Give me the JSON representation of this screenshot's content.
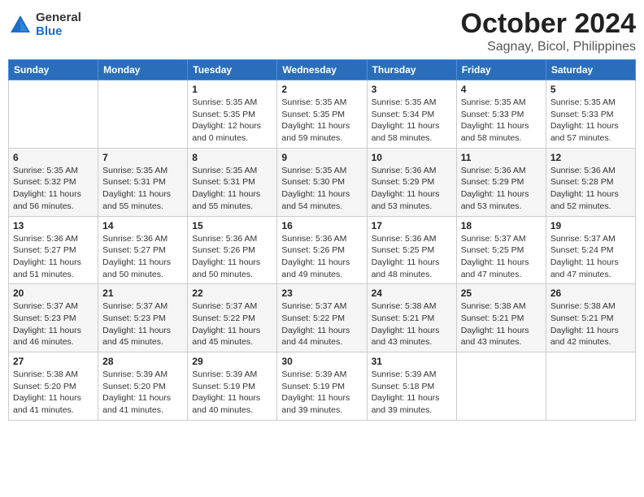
{
  "logo": {
    "general": "General",
    "blue": "Blue"
  },
  "title": "October 2024",
  "location": "Sagnay, Bicol, Philippines",
  "days_header": [
    "Sunday",
    "Monday",
    "Tuesday",
    "Wednesday",
    "Thursday",
    "Friday",
    "Saturday"
  ],
  "weeks": [
    [
      {
        "day": "",
        "sunrise": "",
        "sunset": "",
        "daylight": ""
      },
      {
        "day": "",
        "sunrise": "",
        "sunset": "",
        "daylight": ""
      },
      {
        "day": "1",
        "sunrise": "Sunrise: 5:35 AM",
        "sunset": "Sunset: 5:35 PM",
        "daylight": "Daylight: 12 hours and 0 minutes."
      },
      {
        "day": "2",
        "sunrise": "Sunrise: 5:35 AM",
        "sunset": "Sunset: 5:35 PM",
        "daylight": "Daylight: 11 hours and 59 minutes."
      },
      {
        "day": "3",
        "sunrise": "Sunrise: 5:35 AM",
        "sunset": "Sunset: 5:34 PM",
        "daylight": "Daylight: 11 hours and 58 minutes."
      },
      {
        "day": "4",
        "sunrise": "Sunrise: 5:35 AM",
        "sunset": "Sunset: 5:33 PM",
        "daylight": "Daylight: 11 hours and 58 minutes."
      },
      {
        "day": "5",
        "sunrise": "Sunrise: 5:35 AM",
        "sunset": "Sunset: 5:33 PM",
        "daylight": "Daylight: 11 hours and 57 minutes."
      }
    ],
    [
      {
        "day": "6",
        "sunrise": "Sunrise: 5:35 AM",
        "sunset": "Sunset: 5:32 PM",
        "daylight": "Daylight: 11 hours and 56 minutes."
      },
      {
        "day": "7",
        "sunrise": "Sunrise: 5:35 AM",
        "sunset": "Sunset: 5:31 PM",
        "daylight": "Daylight: 11 hours and 55 minutes."
      },
      {
        "day": "8",
        "sunrise": "Sunrise: 5:35 AM",
        "sunset": "Sunset: 5:31 PM",
        "daylight": "Daylight: 11 hours and 55 minutes."
      },
      {
        "day": "9",
        "sunrise": "Sunrise: 5:35 AM",
        "sunset": "Sunset: 5:30 PM",
        "daylight": "Daylight: 11 hours and 54 minutes."
      },
      {
        "day": "10",
        "sunrise": "Sunrise: 5:36 AM",
        "sunset": "Sunset: 5:29 PM",
        "daylight": "Daylight: 11 hours and 53 minutes."
      },
      {
        "day": "11",
        "sunrise": "Sunrise: 5:36 AM",
        "sunset": "Sunset: 5:29 PM",
        "daylight": "Daylight: 11 hours and 53 minutes."
      },
      {
        "day": "12",
        "sunrise": "Sunrise: 5:36 AM",
        "sunset": "Sunset: 5:28 PM",
        "daylight": "Daylight: 11 hours and 52 minutes."
      }
    ],
    [
      {
        "day": "13",
        "sunrise": "Sunrise: 5:36 AM",
        "sunset": "Sunset: 5:27 PM",
        "daylight": "Daylight: 11 hours and 51 minutes."
      },
      {
        "day": "14",
        "sunrise": "Sunrise: 5:36 AM",
        "sunset": "Sunset: 5:27 PM",
        "daylight": "Daylight: 11 hours and 50 minutes."
      },
      {
        "day": "15",
        "sunrise": "Sunrise: 5:36 AM",
        "sunset": "Sunset: 5:26 PM",
        "daylight": "Daylight: 11 hours and 50 minutes."
      },
      {
        "day": "16",
        "sunrise": "Sunrise: 5:36 AM",
        "sunset": "Sunset: 5:26 PM",
        "daylight": "Daylight: 11 hours and 49 minutes."
      },
      {
        "day": "17",
        "sunrise": "Sunrise: 5:36 AM",
        "sunset": "Sunset: 5:25 PM",
        "daylight": "Daylight: 11 hours and 48 minutes."
      },
      {
        "day": "18",
        "sunrise": "Sunrise: 5:37 AM",
        "sunset": "Sunset: 5:25 PM",
        "daylight": "Daylight: 11 hours and 47 minutes."
      },
      {
        "day": "19",
        "sunrise": "Sunrise: 5:37 AM",
        "sunset": "Sunset: 5:24 PM",
        "daylight": "Daylight: 11 hours and 47 minutes."
      }
    ],
    [
      {
        "day": "20",
        "sunrise": "Sunrise: 5:37 AM",
        "sunset": "Sunset: 5:23 PM",
        "daylight": "Daylight: 11 hours and 46 minutes."
      },
      {
        "day": "21",
        "sunrise": "Sunrise: 5:37 AM",
        "sunset": "Sunset: 5:23 PM",
        "daylight": "Daylight: 11 hours and 45 minutes."
      },
      {
        "day": "22",
        "sunrise": "Sunrise: 5:37 AM",
        "sunset": "Sunset: 5:22 PM",
        "daylight": "Daylight: 11 hours and 45 minutes."
      },
      {
        "day": "23",
        "sunrise": "Sunrise: 5:37 AM",
        "sunset": "Sunset: 5:22 PM",
        "daylight": "Daylight: 11 hours and 44 minutes."
      },
      {
        "day": "24",
        "sunrise": "Sunrise: 5:38 AM",
        "sunset": "Sunset: 5:21 PM",
        "daylight": "Daylight: 11 hours and 43 minutes."
      },
      {
        "day": "25",
        "sunrise": "Sunrise: 5:38 AM",
        "sunset": "Sunset: 5:21 PM",
        "daylight": "Daylight: 11 hours and 43 minutes."
      },
      {
        "day": "26",
        "sunrise": "Sunrise: 5:38 AM",
        "sunset": "Sunset: 5:21 PM",
        "daylight": "Daylight: 11 hours and 42 minutes."
      }
    ],
    [
      {
        "day": "27",
        "sunrise": "Sunrise: 5:38 AM",
        "sunset": "Sunset: 5:20 PM",
        "daylight": "Daylight: 11 hours and 41 minutes."
      },
      {
        "day": "28",
        "sunrise": "Sunrise: 5:39 AM",
        "sunset": "Sunset: 5:20 PM",
        "daylight": "Daylight: 11 hours and 41 minutes."
      },
      {
        "day": "29",
        "sunrise": "Sunrise: 5:39 AM",
        "sunset": "Sunset: 5:19 PM",
        "daylight": "Daylight: 11 hours and 40 minutes."
      },
      {
        "day": "30",
        "sunrise": "Sunrise: 5:39 AM",
        "sunset": "Sunset: 5:19 PM",
        "daylight": "Daylight: 11 hours and 39 minutes."
      },
      {
        "day": "31",
        "sunrise": "Sunrise: 5:39 AM",
        "sunset": "Sunset: 5:18 PM",
        "daylight": "Daylight: 11 hours and 39 minutes."
      },
      {
        "day": "",
        "sunrise": "",
        "sunset": "",
        "daylight": ""
      },
      {
        "day": "",
        "sunrise": "",
        "sunset": "",
        "daylight": ""
      }
    ]
  ]
}
